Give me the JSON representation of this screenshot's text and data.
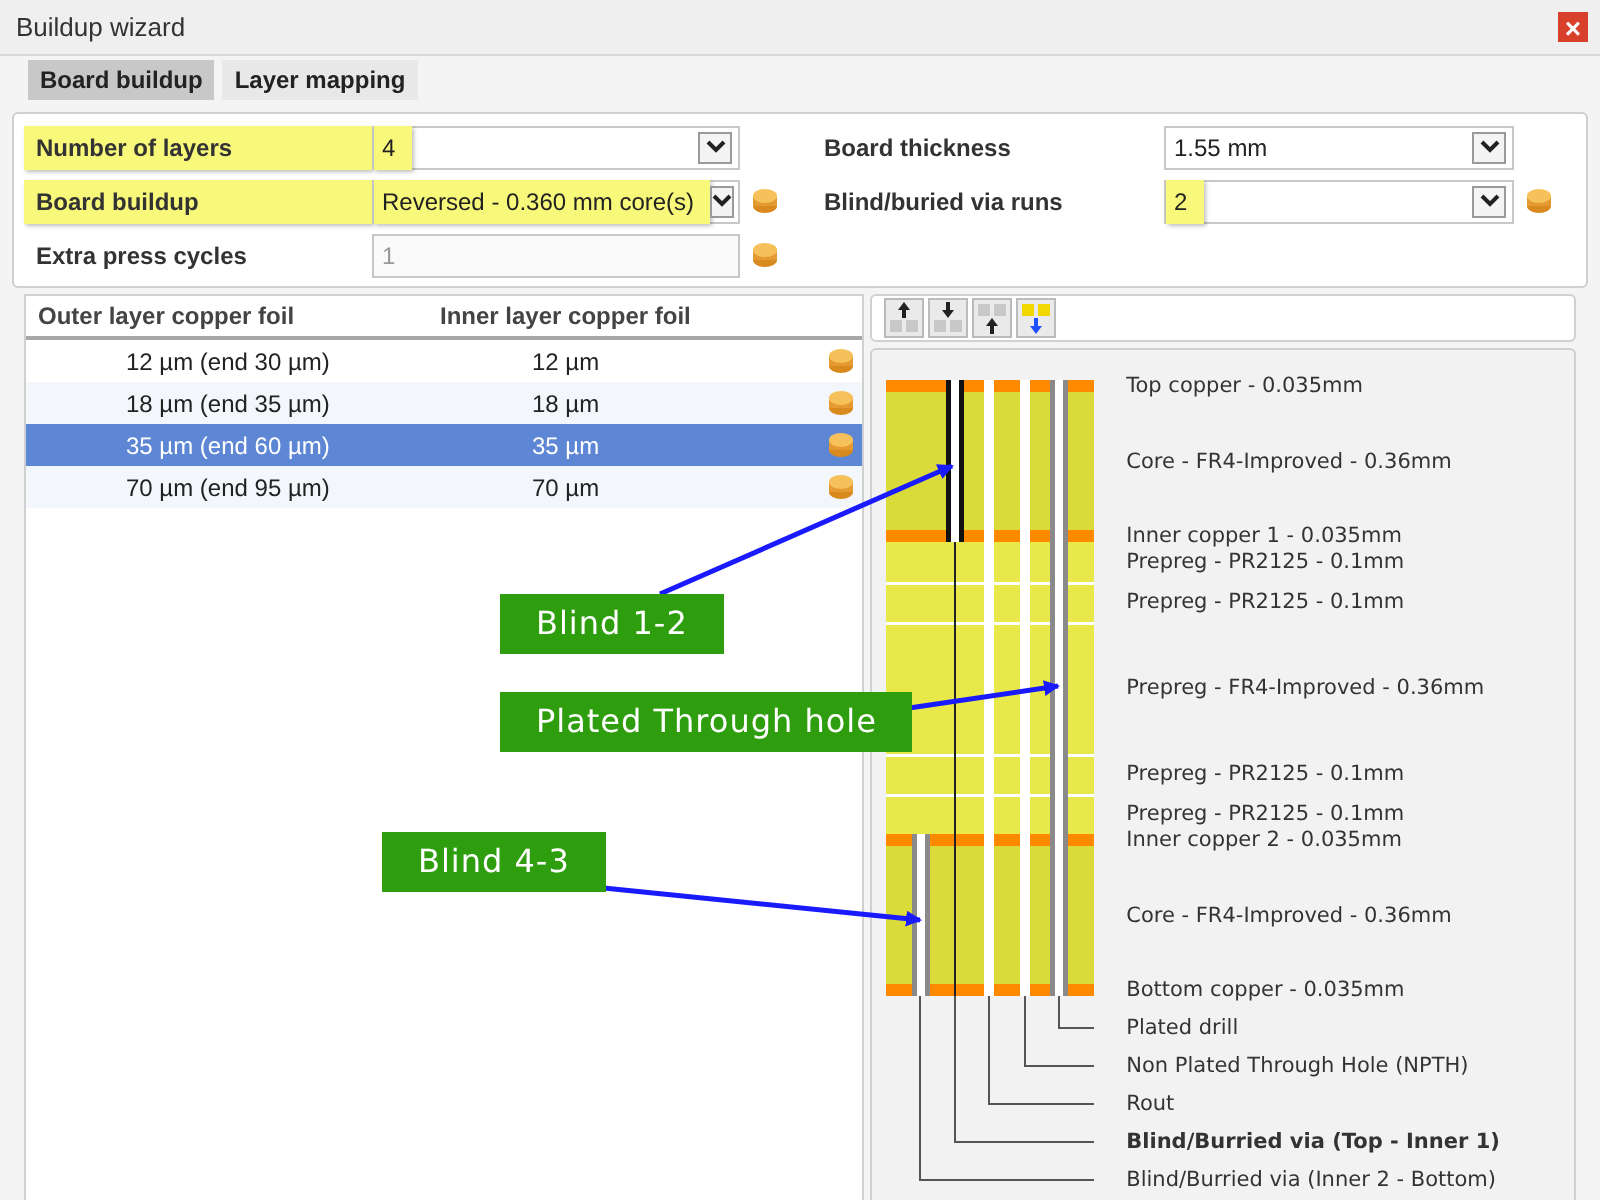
{
  "window": {
    "title": "Buildup wizard",
    "close": "×"
  },
  "tabs": [
    {
      "label": "Board buildup",
      "selected": true
    },
    {
      "label": "Layer mapping",
      "selected": false
    }
  ],
  "form": {
    "left": [
      {
        "label": "Number of layers",
        "value": "4",
        "kind": "select",
        "disabled": false,
        "label_highlighted": true,
        "value_highlighted": true,
        "coin": false
      },
      {
        "label": "Board buildup",
        "value": "Reversed - 0.360 mm core(s)",
        "kind": "select",
        "disabled": false,
        "label_highlighted": true,
        "value_highlighted": true,
        "coin": true
      },
      {
        "label": "Extra press cycles",
        "value": "1",
        "kind": "input",
        "disabled": true,
        "label_highlighted": false,
        "value_highlighted": false,
        "coin": true
      }
    ],
    "right": [
      {
        "label": "Board thickness",
        "value": "1.55 mm",
        "kind": "select",
        "disabled": false,
        "label_highlighted": false,
        "value_highlighted": false,
        "coin": false
      },
      {
        "label": "Blind/buried via runs",
        "value": "2",
        "kind": "select",
        "disabled": false,
        "label_highlighted": false,
        "value_highlighted": true,
        "coin": true
      }
    ]
  },
  "copper_table": {
    "columns": [
      "Outer layer copper foil",
      "Inner layer copper foil"
    ],
    "rows": [
      {
        "outer": "12 µm (end 30 µm)",
        "inner": "12 µm",
        "selected": false
      },
      {
        "outer": "18 µm (end 35 µm)",
        "inner": "18 µm",
        "selected": false
      },
      {
        "outer": "35 µm (end 60 µm)",
        "inner": "35 µm",
        "selected": true
      },
      {
        "outer": "70 µm (end 95 µm)",
        "inner": "70 µm",
        "selected": false
      }
    ]
  },
  "stackup": {
    "layers": [
      {
        "kind": "copper",
        "label": "Top copper - 0.035mm"
      },
      {
        "kind": "core",
        "label": "Core - FR4-Improved - 0.36mm"
      },
      {
        "kind": "copper",
        "label": "Inner copper 1 - 0.035mm"
      },
      {
        "kind": "prepreg",
        "label": "Prepreg - PR2125 - 0.1mm"
      },
      {
        "kind": "prepreg",
        "label": "Prepreg - PR2125 - 0.1mm"
      },
      {
        "kind": "prepreg_thick",
        "label": "Prepreg - FR4-Improved - 0.36mm"
      },
      {
        "kind": "prepreg",
        "label": "Prepreg - PR2125 - 0.1mm"
      },
      {
        "kind": "prepreg",
        "label": "Prepreg - PR2125 - 0.1mm"
      },
      {
        "kind": "copper",
        "label": "Inner copper 2 - 0.035mm"
      },
      {
        "kind": "core",
        "label": "Core - FR4-Improved - 0.36mm"
      },
      {
        "kind": "copper",
        "label": "Bottom copper - 0.035mm"
      }
    ],
    "legend": [
      {
        "label": "Plated drill",
        "selected": false
      },
      {
        "label": "Non Plated Through Hole (NPTH)",
        "selected": false
      },
      {
        "label": "Rout",
        "selected": false
      },
      {
        "label": "Blind/Burried via (Top - Inner 1)",
        "selected": true
      },
      {
        "label": "Blind/Burried via (Inner 2 - Bottom)",
        "selected": false
      }
    ]
  },
  "callouts": [
    {
      "text": "Blind 1-2"
    },
    {
      "text": "Plated Through hole"
    },
    {
      "text": "Blind 4-3"
    }
  ]
}
